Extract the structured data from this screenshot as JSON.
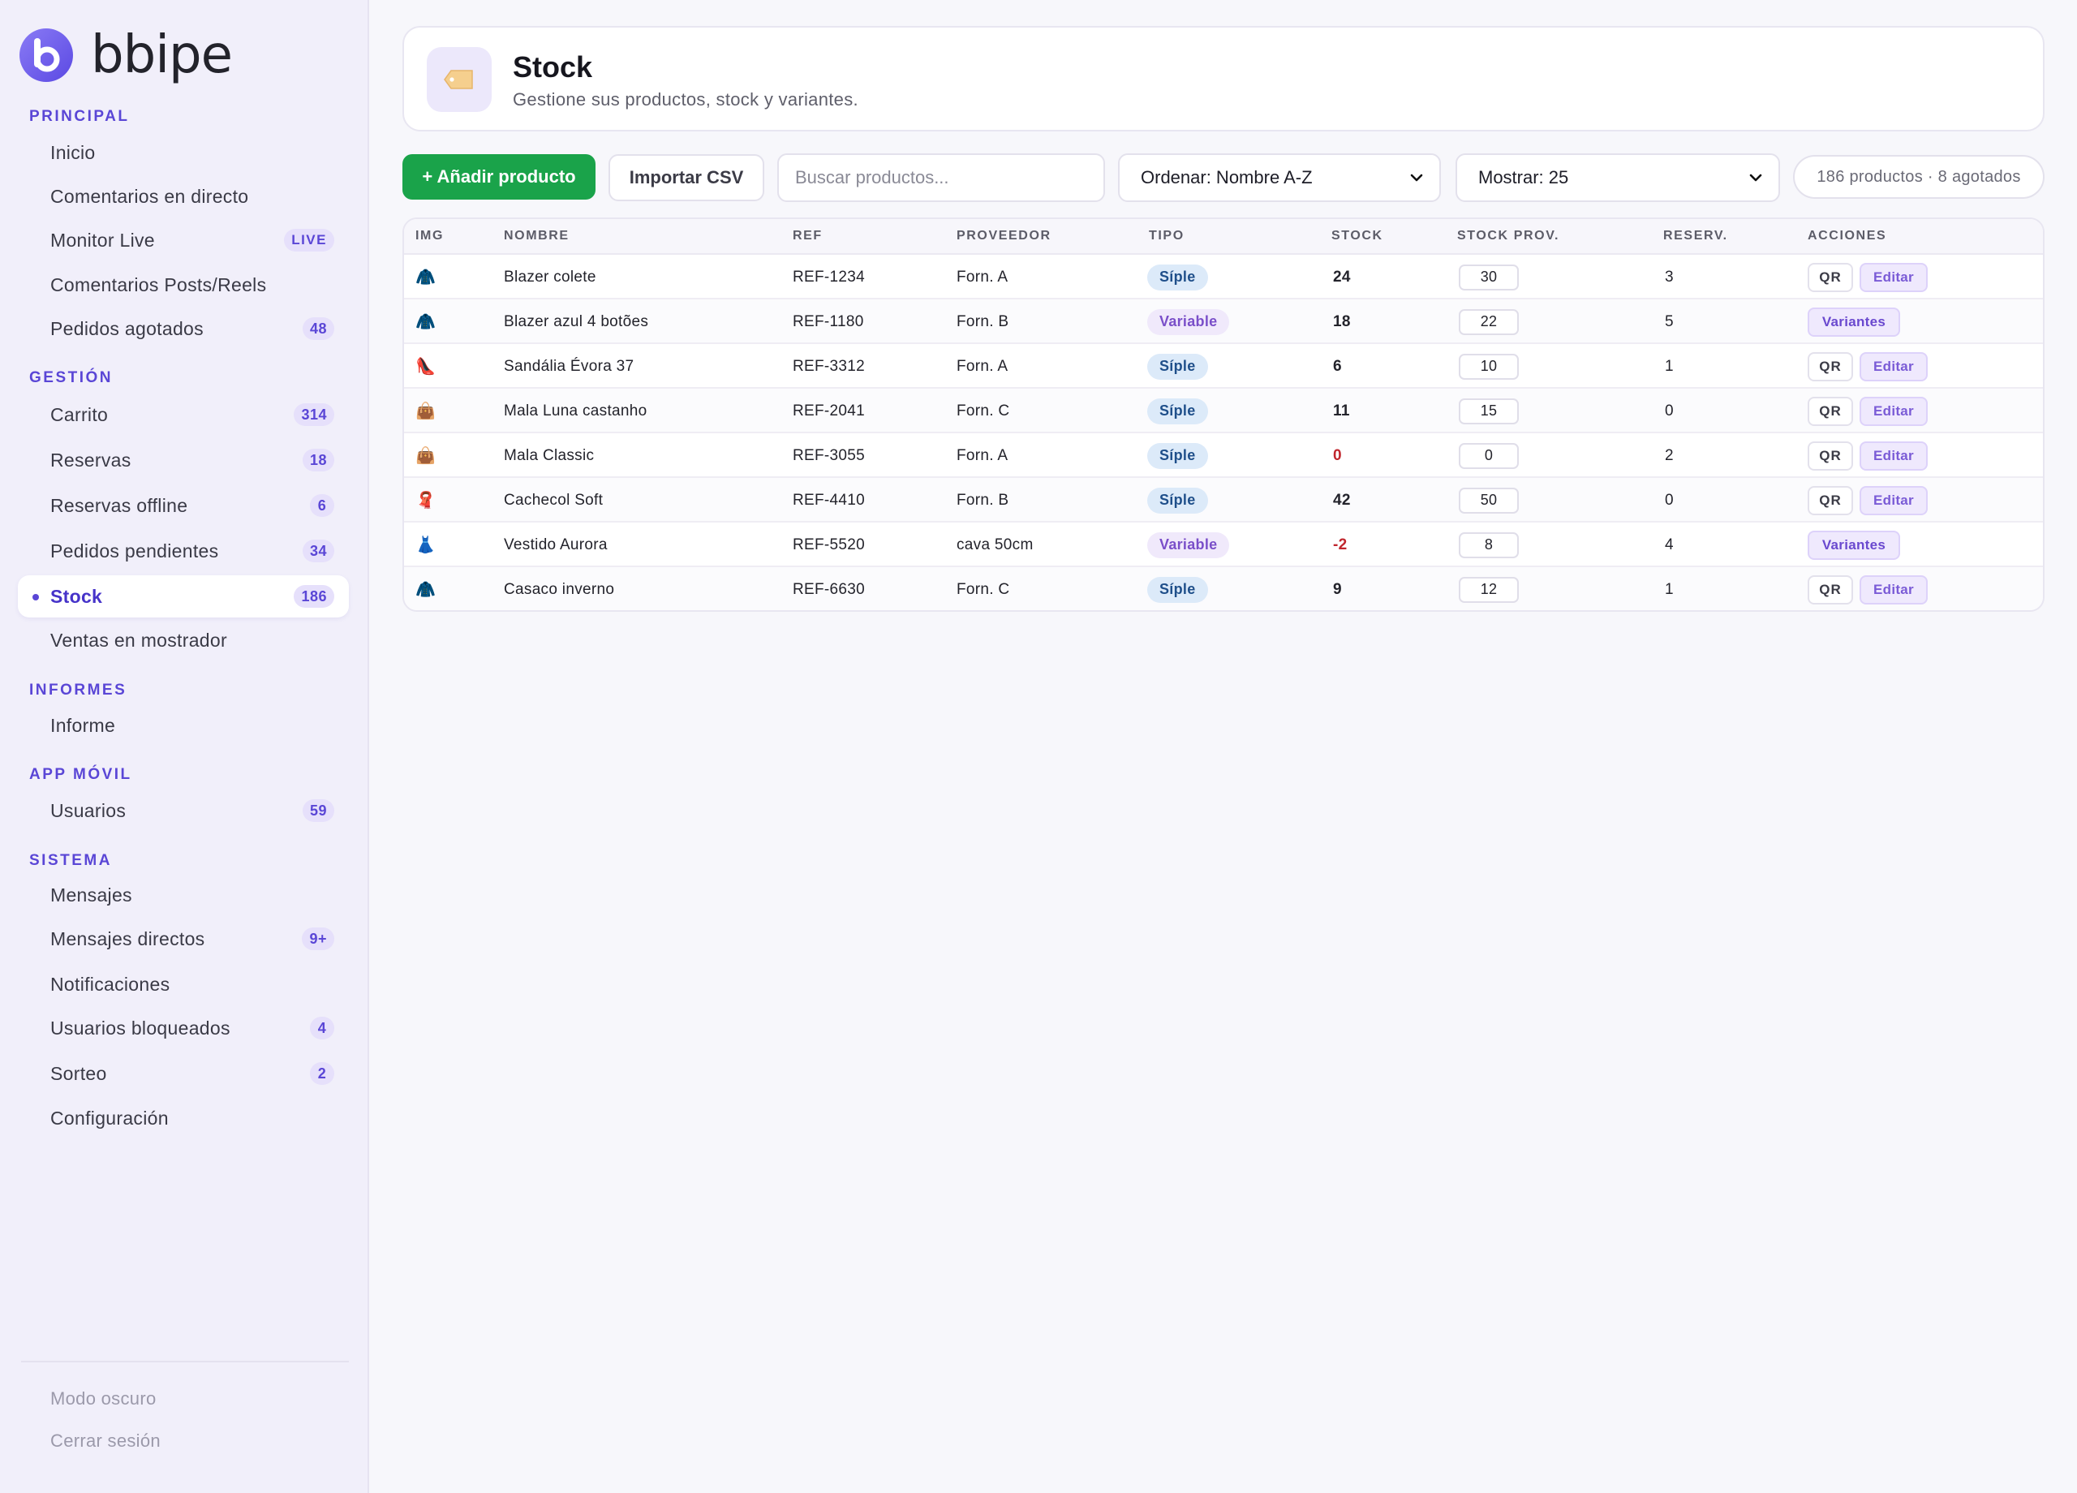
{
  "brand": {
    "name": "bbipe"
  },
  "sidebar": {
    "sections": [
      {
        "title": "PRINCIPAL",
        "items": [
          {
            "label": "Inicio",
            "badge": ""
          },
          {
            "label": "Comentarios en directo",
            "badge": ""
          },
          {
            "label": "Monitor Live",
            "badge": "LIVE"
          },
          {
            "label": "Comentarios Posts/Reels",
            "badge": ""
          },
          {
            "label": "Pedidos agotados",
            "badge": "48"
          }
        ]
      },
      {
        "title": "GESTIÓN",
        "items": [
          {
            "label": "Carrito",
            "badge": "314"
          },
          {
            "label": "Reservas",
            "badge": "18"
          },
          {
            "label": "Reservas offline",
            "badge": "6"
          },
          {
            "label": "Pedidos pendientes",
            "badge": "34"
          },
          {
            "label": "Stock",
            "badge": "186",
            "active": true
          },
          {
            "label": "Ventas en mostrador",
            "badge": ""
          }
        ]
      },
      {
        "title": "INFORMES",
        "items": [
          {
            "label": "Informe",
            "badge": ""
          }
        ]
      },
      {
        "title": "APP MÓVIL",
        "items": [
          {
            "label": "Usuarios",
            "badge": "59"
          }
        ]
      },
      {
        "title": "SISTEMA",
        "items": [
          {
            "label": "Mensajes",
            "badge": ""
          },
          {
            "label": "Mensajes directos",
            "badge": "9+"
          },
          {
            "label": "Notificaciones",
            "badge": ""
          },
          {
            "label": "Usuarios bloqueados",
            "badge": "4"
          },
          {
            "label": "Sorteo",
            "badge": "2"
          },
          {
            "label": "Configuración",
            "badge": ""
          }
        ]
      }
    ],
    "footer": {
      "dark_mode": "Modo oscuro",
      "logout": "Cerrar sesión"
    }
  },
  "header": {
    "icon": "price-tag-icon",
    "title": "Stock",
    "subtitle": "Gestione sus productos, stock y variantes."
  },
  "toolbar": {
    "add_label": "+ Añadir producto",
    "import_label": "Importar CSV",
    "search_placeholder": "Buscar productos...",
    "sort_value": "Ordenar: Nombre A-Z",
    "show_value": "Mostrar: 25",
    "count_text": "186 productos · 8 agotados"
  },
  "table": {
    "columns": [
      "IMG",
      "NOMBRE",
      "REF",
      "PROVEEDOR",
      "TIPO",
      "STOCK",
      "STOCK PROV.",
      "RESERV.",
      "ACCIONES"
    ],
    "actions": {
      "qr": "QR",
      "edit": "Editar",
      "variants": "Variantes"
    },
    "rows": [
      {
        "img": "🧥",
        "name": "Blazer colete",
        "ref": "REF-1234",
        "supplier": "Forn. A",
        "type": "Síple",
        "type_kind": "simple",
        "stock": "24",
        "stock_prov": "30",
        "reserved": "3"
      },
      {
        "img": "🧥",
        "name": "Blazer azul 4 botões",
        "ref": "REF-1180",
        "supplier": "Forn. B",
        "type": "Variable",
        "type_kind": "variable",
        "stock": "18",
        "stock_prov": "22",
        "reserved": "5"
      },
      {
        "img": "👠",
        "name": "Sandália Évora 37",
        "ref": "REF-3312",
        "supplier": "Forn. A",
        "type": "Síple",
        "type_kind": "simple",
        "stock": "6",
        "stock_prov": "10",
        "reserved": "1"
      },
      {
        "img": "👜",
        "name": "Mala Luna castanho",
        "ref": "REF-2041",
        "supplier": "Forn. C",
        "type": "Síple",
        "type_kind": "simple",
        "stock": "11",
        "stock_prov": "15",
        "reserved": "0"
      },
      {
        "img": "👜",
        "name": "Mala Classic",
        "ref": "REF-3055",
        "supplier": "Forn. A",
        "type": "Síple",
        "type_kind": "simple",
        "stock": "0",
        "stock_prov": "0",
        "reserved": "2"
      },
      {
        "img": "🧣",
        "name": "Cachecol Soft",
        "ref": "REF-4410",
        "supplier": "Forn. B",
        "type": "Síple",
        "type_kind": "simple",
        "stock": "42",
        "stock_prov": "50",
        "reserved": "0"
      },
      {
        "img": "👗",
        "name": "Vestido Aurora",
        "ref": "REF-5520",
        "supplier": "cava 50cm",
        "type": "Variable",
        "type_kind": "variable",
        "stock": "-2",
        "stock_prov": "8",
        "reserved": "4"
      },
      {
        "img": "🧥",
        "name": "Casaco inverno",
        "ref": "REF-6630",
        "supplier": "Forn. C",
        "type": "Síple",
        "type_kind": "simple",
        "stock": "9",
        "stock_prov": "12",
        "reserved": "1"
      }
    ]
  },
  "colors": {
    "accent": "#5a46d6",
    "primary_button": "#1aa34a",
    "negative_stock": "#c0262d",
    "sidebar_bg": "#f1effa"
  }
}
